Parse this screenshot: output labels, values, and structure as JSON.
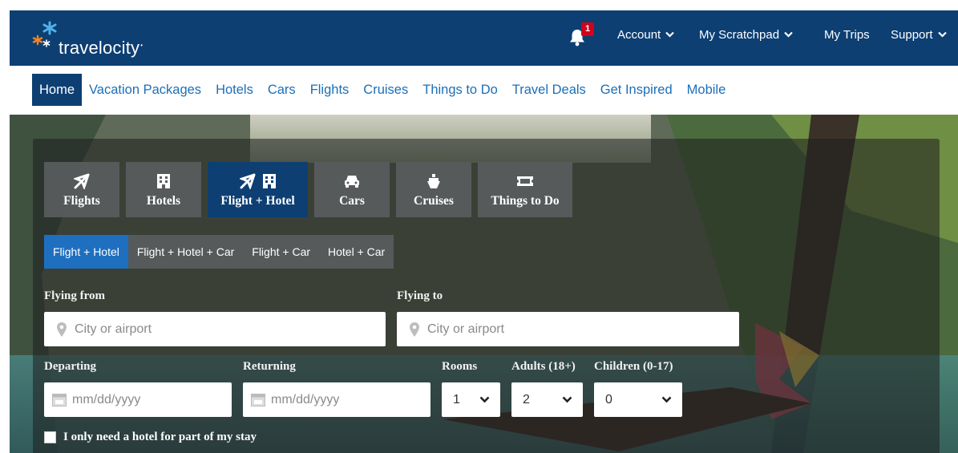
{
  "brand": {
    "name": "travelocity",
    "tm": "•"
  },
  "header": {
    "notifications": {
      "count": "1"
    },
    "menu": [
      {
        "label": "Account",
        "has_chevron": true
      },
      {
        "label": "My Scratchpad",
        "has_chevron": true
      },
      {
        "label": "My Trips",
        "has_chevron": false
      },
      {
        "label": "Support",
        "has_chevron": true
      }
    ]
  },
  "nav": {
    "items": [
      "Home",
      "Vacation Packages",
      "Hotels",
      "Cars",
      "Flights",
      "Cruises",
      "Things to Do",
      "Travel Deals",
      "Get Inspired",
      "Mobile"
    ],
    "active": "Home"
  },
  "search": {
    "tabs": [
      {
        "label": "Flights",
        "icon": "plane-icon"
      },
      {
        "label": "Hotels",
        "icon": "building-icon"
      },
      {
        "label": "Flight + Hotel",
        "icon": "plane-building-icon",
        "active": true
      },
      {
        "label": "Cars",
        "icon": "car-icon"
      },
      {
        "label": "Cruises",
        "icon": "ship-icon"
      },
      {
        "label": "Things to Do",
        "icon": "ticket-icon"
      }
    ],
    "subtabs": [
      "Flight + Hotel",
      "Flight + Hotel + Car",
      "Flight + Car",
      "Hotel + Car"
    ],
    "active_subtab": "Flight + Hotel",
    "flying_from": {
      "label": "Flying from",
      "placeholder": "City or airport"
    },
    "flying_to": {
      "label": "Flying to",
      "placeholder": "City or airport"
    },
    "departing": {
      "label": "Departing",
      "placeholder": "mm/dd/yyyy"
    },
    "returning": {
      "label": "Returning",
      "placeholder": "mm/dd/yyyy"
    },
    "rooms": {
      "label": "Rooms",
      "value": "1"
    },
    "adults": {
      "label": "Adults (18+)",
      "value": "2"
    },
    "children": {
      "label": "Children (0-17)",
      "value": "0"
    },
    "partial_stay": {
      "label": "I only need a hotel for part of my stay",
      "checked": false
    }
  },
  "colors": {
    "header_bg": "#0d3f73",
    "link": "#1b6fb8",
    "active_subtab": "#1e6fc0",
    "badge": "#d0021b",
    "logo_orange": "#f5841f",
    "logo_blue": "#4fb3e8"
  }
}
